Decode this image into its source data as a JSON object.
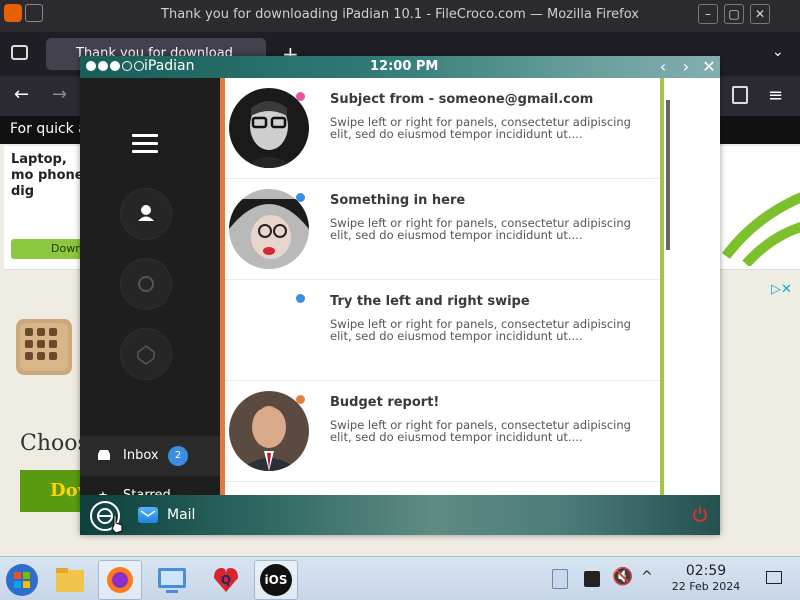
{
  "browser": {
    "window_title": "Thank you for downloading iPadian 10.1 - FileCroco.com — Mozilla Firefox",
    "tab_title": "Thank you for download",
    "quick_bar_text": "For quick a",
    "ad_text": "Laptop, mo phone, dig",
    "ad_button": "Down",
    "choose_text": "Choos",
    "download_big": "Dow"
  },
  "ipadian": {
    "brand": "iPadian",
    "clock": "12:00 PM",
    "sidebar": {
      "nav": [
        {
          "label": "Inbox",
          "badge": "2"
        },
        {
          "label": "Starred"
        }
      ]
    },
    "messages": [
      {
        "subject": "Subject from - someone@gmail.com",
        "preview": "Swipe left or right for panels, consectetur adipiscing elit, sed do eiusmod tempor incididunt ut....",
        "dot_color": "#e8559a",
        "avatar": "man-glasses"
      },
      {
        "subject": "Something in here",
        "preview": "Swipe left or right for panels, consectetur adipiscing elit, sed do eiusmod tempor incididunt ut....",
        "dot_color": "#3a8ee0",
        "avatar": "woman-hat"
      },
      {
        "subject": "Try the left and right swipe",
        "preview": "Swipe left or right for panels, consectetur adipiscing elit, sed do eiusmod tempor incididunt ut....",
        "dot_color": "#3a8ee0",
        "avatar": "none"
      },
      {
        "subject": "Budget report!",
        "preview": "Swipe left or right for panels, consectetur adipiscing elit, sed do eiusmod tempor incididunt ut....",
        "dot_color": "#e0823a",
        "avatar": "man-suit"
      }
    ],
    "dock": {
      "mail_label": "Mail"
    }
  },
  "taskbar": {
    "ios_label": "iOS",
    "time": "02:59",
    "date": "22 Feb 2024"
  }
}
